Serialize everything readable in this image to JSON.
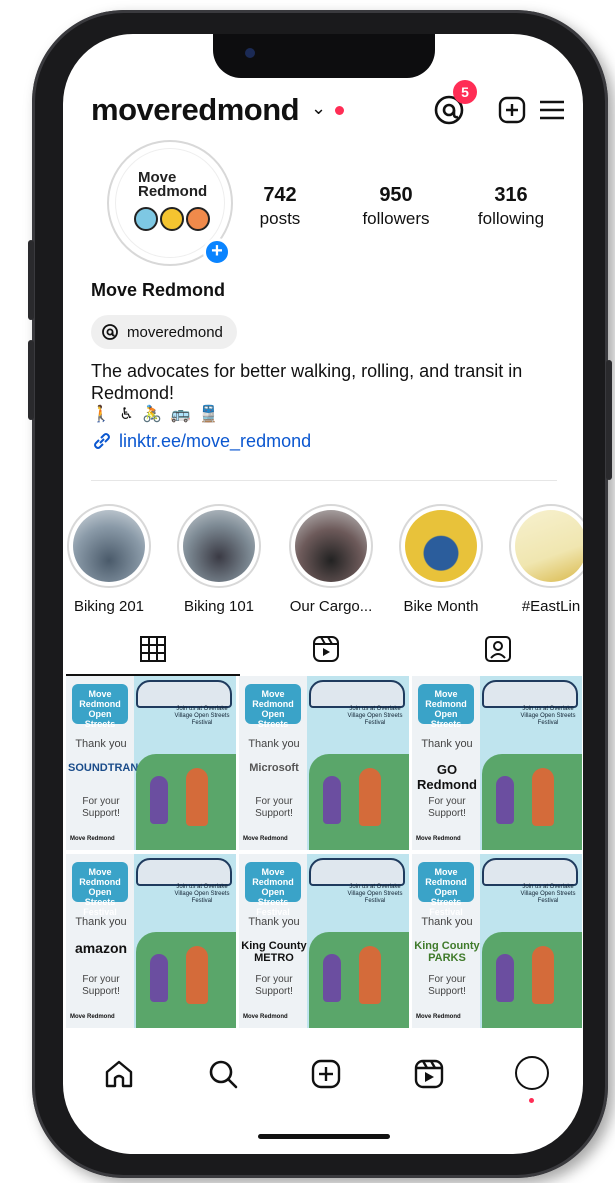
{
  "header": {
    "username": "moveredmond",
    "chevron": "⌄",
    "notification_count": "5",
    "threads_icon": "threads-icon",
    "add_icon": "plus-square-icon",
    "menu_icon": "hamburger-menu-icon"
  },
  "profile": {
    "avatar_text_line1": "Move",
    "avatar_text_line2": "Redmond",
    "add_story_label": "+",
    "stats": [
      {
        "value": "742",
        "label": "posts"
      },
      {
        "value": "950",
        "label": "followers"
      },
      {
        "value": "316",
        "label": "following"
      }
    ],
    "display_name": "Move Redmond",
    "threads_handle": "moveredmond",
    "bio": "The advocates for better walking, rolling, and transit in Redmond!",
    "emojis": "🚶 ♿ 🚴 🚌 🚆",
    "link": "linktr.ee/move_redmond"
  },
  "highlights": [
    {
      "label": "Biking 201",
      "color": "#8a9aa8"
    },
    {
      "label": "Biking 101",
      "color": "#7f8c96"
    },
    {
      "label": "Our Cargo...",
      "color": "#6d5a5a"
    },
    {
      "label": "Bike Month",
      "color": "#e8c23a"
    },
    {
      "label": "#EastLin",
      "color": "#f0e6b0"
    }
  ],
  "tabs": {
    "grid_icon": "grid-icon",
    "reels_icon": "reels-icon",
    "tagged_icon": "tagged-user-icon"
  },
  "posts": [
    {
      "logo": "Move Redmond Open Streets",
      "thanks": "Thank you",
      "sponsor": "SOUNDTRANSIT",
      "support": "For your Support!",
      "footer": "Move Redmond",
      "info": "Join us at Overlake Village Open Streets Festival"
    },
    {
      "logo": "Move Redmond Open Streets",
      "thanks": "Thank you",
      "sponsor": "Microsoft",
      "support": "For your Support!",
      "footer": "Move Redmond",
      "info": "Join us at Overlake Village Open Streets Festival"
    },
    {
      "logo": "Move Redmond Open Streets",
      "thanks": "Thank you",
      "sponsor": "GO Redmond",
      "support": "For your Support!",
      "footer": "Move Redmond",
      "info": "Join us at Overlake Village Open Streets Festival"
    },
    {
      "logo": "Move Redmond Open Streets Festival",
      "thanks": "Thank you",
      "sponsor": "amazon",
      "support": "For your Support!",
      "footer": "Move Redmond",
      "info": "Join us at Overlake Village Open Streets Festival"
    },
    {
      "logo": "Move Redmond Open Streets Festival",
      "thanks": "Thank you",
      "sponsor": "King County METRO",
      "support": "For your Support!",
      "footer": "Move Redmond",
      "info": "Join us at Overlake Village Open Streets Festival"
    },
    {
      "logo": "Move Redmond Open Streets Festival",
      "thanks": "Thank you",
      "sponsor": "King County PARKS",
      "support": "For your Support!",
      "footer": "Move Redmond",
      "info": "Join us at Overlake Village Open Streets Festival"
    }
  ],
  "bottom_nav": {
    "home_icon": "home-icon",
    "search_icon": "search-icon",
    "create_icon": "plus-square-icon",
    "reels_icon": "reels-icon",
    "profile_icon": "profile-avatar-icon"
  },
  "colors": {
    "accent_red": "#ff2d55",
    "link_blue": "#0b57d0",
    "story_blue": "#0a84ff"
  }
}
